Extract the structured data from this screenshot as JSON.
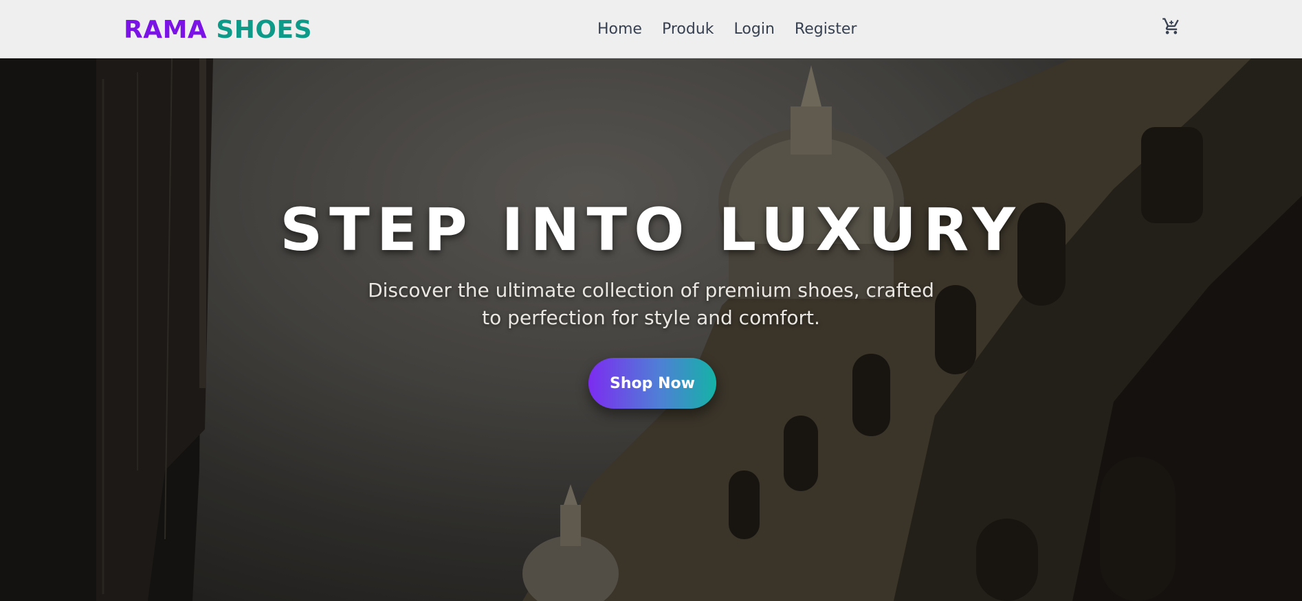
{
  "nav": {
    "brand_part1": "RAMA",
    "brand_part2": "SHOES",
    "links": [
      "Home",
      "Produk",
      "Login",
      "Register"
    ],
    "cart_icon": "shopping-cart-icon"
  },
  "hero": {
    "title": "STEP INTO LUXURY",
    "subtitle": "Discover the ultimate collection of premium shoes, crafted to perfection for style and comfort.",
    "cta_label": "Shop Now"
  },
  "colors": {
    "brand_purple": "#7b12e6",
    "brand_teal": "#0e9a88",
    "cta_gradient_start": "#7c2cf0",
    "cta_gradient_end": "#14b3a6",
    "nav_text": "#374151"
  }
}
